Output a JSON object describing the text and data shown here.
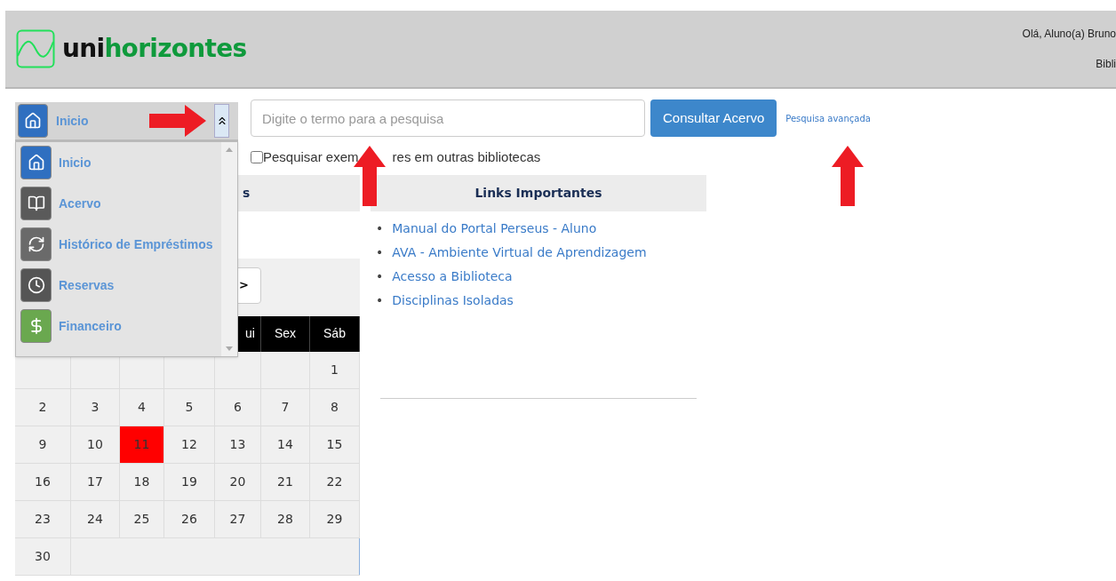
{
  "header": {
    "logo": {
      "prefix": "uni",
      "suffix": "horizontes"
    },
    "greeting": "Olá, Aluno(a) Bruno",
    "link": "Bibli"
  },
  "menu": {
    "current": "Inicio",
    "expanded": true,
    "items": [
      {
        "label": "Inicio",
        "kind": "home"
      },
      {
        "label": "Acervo",
        "kind": "books"
      },
      {
        "label": "Histórico de Empréstimos",
        "kind": "history"
      },
      {
        "label": "Reservas",
        "kind": "clock"
      },
      {
        "label": "Financeiro",
        "kind": "money"
      }
    ]
  },
  "search": {
    "placeholder": "Digite o termo para a pesquisa",
    "button": "Consultar Acervo",
    "advanced": "Pesquisa avançada",
    "other_libraries": {
      "label": [
        "Pesquisar exem",
        "res em outras bibliotecas"
      ],
      "checked": false
    }
  },
  "left_panel": {
    "heading": "s",
    "nav_button": ">",
    "weekdays": [
      "ui",
      "Sex",
      "Sáb"
    ],
    "weeks": [
      [
        {
          "selected": false
        },
        {
          "selected": false
        },
        {
          "selected": false
        },
        {
          "selected": false
        },
        {
          "selected": false
        },
        {
          "selected": false
        },
        {
          "day": "1",
          "selected": false
        }
      ],
      [
        {
          "day": "2",
          "selected": false
        },
        {
          "day": "3",
          "selected": false
        },
        {
          "day": "4",
          "selected": false
        },
        {
          "day": "5",
          "selected": false
        },
        {
          "day": "6",
          "selected": false
        },
        {
          "day": "7",
          "selected": false
        },
        {
          "day": "8",
          "selected": false
        }
      ],
      [
        {
          "day": "9",
          "selected": false
        },
        {
          "day": "10",
          "selected": false
        },
        {
          "day": "11",
          "selected": true
        },
        {
          "day": "12",
          "selected": false
        },
        {
          "day": "13",
          "selected": false
        },
        {
          "day": "14",
          "selected": false
        },
        {
          "day": "15",
          "selected": false
        }
      ],
      [
        {
          "day": "16",
          "selected": false
        },
        {
          "day": "17",
          "selected": false
        },
        {
          "day": "18",
          "selected": false
        },
        {
          "day": "19",
          "selected": false
        },
        {
          "day": "20",
          "selected": false
        },
        {
          "day": "21",
          "selected": false
        },
        {
          "day": "22",
          "selected": false
        }
      ],
      [
        {
          "day": "23",
          "selected": false
        },
        {
          "day": "24",
          "selected": false
        },
        {
          "day": "25",
          "selected": false
        },
        {
          "day": "26",
          "selected": false
        },
        {
          "day": "27",
          "selected": false
        },
        {
          "day": "28",
          "selected": false
        },
        {
          "day": "29",
          "selected": false
        }
      ],
      [
        {
          "day": "30",
          "selected": false
        }
      ]
    ]
  },
  "links_panel": {
    "heading": "Links Importantes",
    "links": [
      {
        "bullet": "•",
        "text": "Manual do Portal Perseus - Aluno"
      },
      {
        "bullet": "•",
        "text": "AVA - Ambiente Virtual de Aprendizagem"
      },
      {
        "bullet": "•",
        "text": "Acesso a Biblioteca"
      },
      {
        "bullet": "•",
        "text": "Disciplinas Isoladas"
      }
    ]
  }
}
